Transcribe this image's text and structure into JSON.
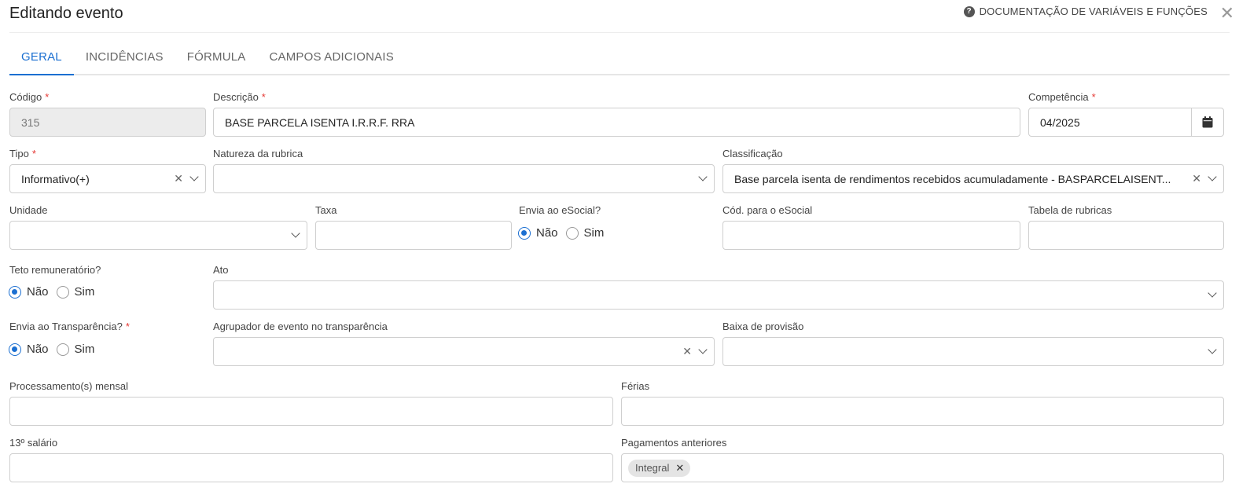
{
  "header": {
    "title": "Editando evento",
    "doc_link": "DOCUMENTAÇÃO DE VARIÁVEIS E FUNÇÕES",
    "close": "✕"
  },
  "tabs": [
    {
      "label": "GERAL",
      "active": true
    },
    {
      "label": "INCIDÊNCIAS"
    },
    {
      "label": "FÓRMULA"
    },
    {
      "label": "CAMPOS ADICIONAIS"
    }
  ],
  "required_mark": "*",
  "form": {
    "codigo": {
      "label": "Código",
      "value": "315"
    },
    "descricao": {
      "label": "Descrição",
      "value": "BASE PARCELA ISENTA I.R.R.F. RRA"
    },
    "competencia": {
      "label": "Competência",
      "value": "04/2025"
    },
    "tipo": {
      "label": "Tipo",
      "value": "Informativo(+)"
    },
    "natureza": {
      "label": "Natureza da rubrica",
      "value": ""
    },
    "classificacao": {
      "label": "Classificação",
      "value": "Base parcela isenta de rendimentos recebidos acumuladamente - BASPARCELAISENT..."
    },
    "unidade": {
      "label": "Unidade",
      "value": ""
    },
    "taxa": {
      "label": "Taxa",
      "value": ""
    },
    "envia_esocial": {
      "label": "Envia ao eSocial?",
      "options": [
        "Não",
        "Sim"
      ],
      "selected": "Não"
    },
    "cod_esocial": {
      "label": "Cód. para o eSocial",
      "value": ""
    },
    "tabela_rubricas": {
      "label": "Tabela de rubricas",
      "value": ""
    },
    "teto": {
      "label": "Teto remuneratório?",
      "options": [
        "Não",
        "Sim"
      ],
      "selected": "Não"
    },
    "ato": {
      "label": "Ato",
      "value": ""
    },
    "envia_transparencia": {
      "label": "Envia ao Transparência?",
      "options": [
        "Não",
        "Sim"
      ],
      "selected": "Não"
    },
    "agrupador": {
      "label": "Agrupador de evento no transparência",
      "value": ""
    },
    "baixa_provisao": {
      "label": "Baixa de provisão",
      "value": ""
    },
    "processamento_mensal": {
      "label": "Processamento(s) mensal",
      "value": ""
    },
    "ferias": {
      "label": "Férias",
      "value": ""
    },
    "decimo_terceiro": {
      "label": "13º salário",
      "value": ""
    },
    "pagamentos_anteriores": {
      "label": "Pagamentos anteriores",
      "chips": [
        "Integral"
      ]
    }
  },
  "colors": {
    "accent": "#1b6fd1",
    "required": "#e53935",
    "disabled_bg": "#ececec"
  },
  "icons": {
    "help": "question-circle-icon",
    "close": "close-icon",
    "calendar": "calendar-icon",
    "chevron": "chevron-down-icon",
    "clear": "clear-icon"
  }
}
